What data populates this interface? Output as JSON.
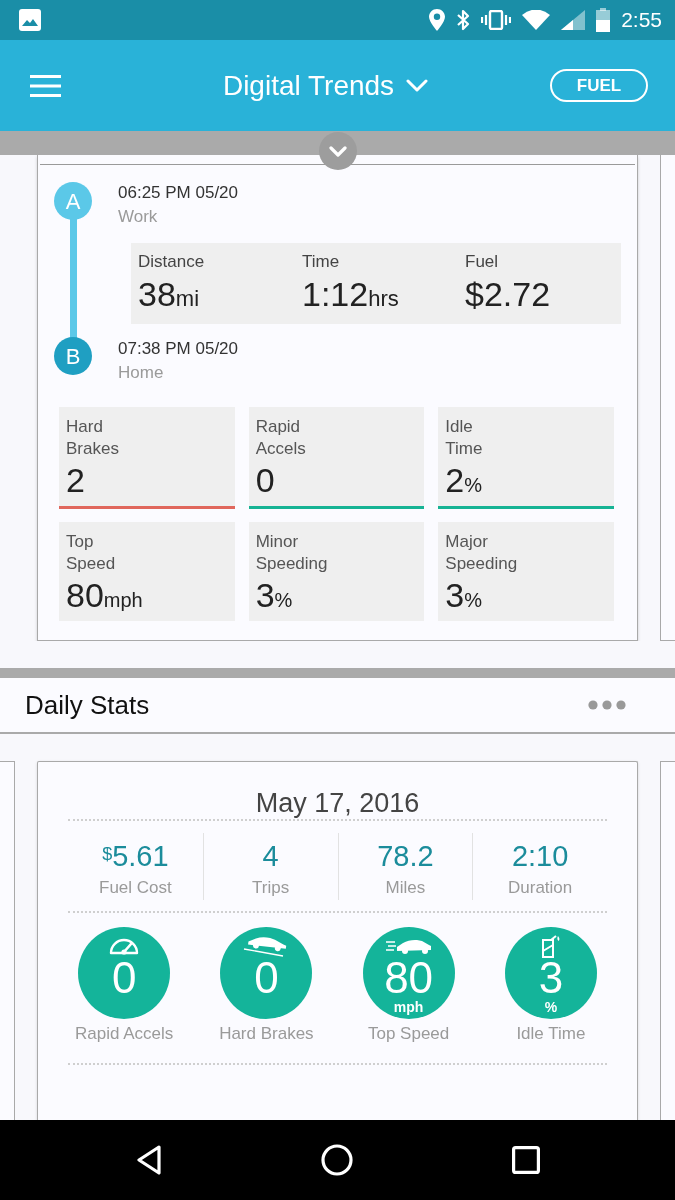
{
  "status_bar": {
    "time": "2:55"
  },
  "app_bar": {
    "title": "Digital Trends",
    "action": "FUEL"
  },
  "trip": {
    "start": {
      "marker": "A",
      "time": "06:25 PM 05/20",
      "place": "Work"
    },
    "summary": [
      {
        "label": "Distance",
        "value": "38",
        "unit": "mi"
      },
      {
        "label": "Time",
        "value": "1:12",
        "unit": "hrs"
      },
      {
        "label": "Fuel",
        "value": "$2.72"
      }
    ],
    "end": {
      "marker": "B",
      "time": "07:38 PM 05/20",
      "place": "Home"
    },
    "events": [
      {
        "label": "Hard Brakes",
        "value": "2",
        "color": "#e0675c"
      },
      {
        "label": "Rapid Accels",
        "value": "0",
        "color": "#17b394"
      },
      {
        "label": "Idle Time",
        "value": "2",
        "unit": "%",
        "color": "#17b394"
      },
      {
        "label": "Top Speed",
        "value": "80",
        "unit": "mph"
      },
      {
        "label": "Minor Speeding",
        "value": "3",
        "unit": "%"
      },
      {
        "label": "Major Speeding",
        "value": "3",
        "unit": "%"
      }
    ]
  },
  "daily_stats": {
    "title": "Daily Stats",
    "date": "May 17, 2016",
    "totals": [
      {
        "currency": "$",
        "value": "5.61",
        "label": "Fuel Cost"
      },
      {
        "value": "4",
        "label": "Trips"
      },
      {
        "value": "78.2",
        "label": "Miles"
      },
      {
        "value": "2:10",
        "label": "Duration"
      }
    ],
    "badges": [
      {
        "kind": "gauge",
        "value": "0",
        "label": "Rapid Accels"
      },
      {
        "kind": "braking",
        "value": "0",
        "label": "Hard Brakes"
      },
      {
        "kind": "speed",
        "value": "80",
        "unit": "mph",
        "label": "Top Speed"
      },
      {
        "kind": "fuel",
        "value": "3",
        "unit": "%",
        "label": "Idle Time"
      }
    ]
  }
}
